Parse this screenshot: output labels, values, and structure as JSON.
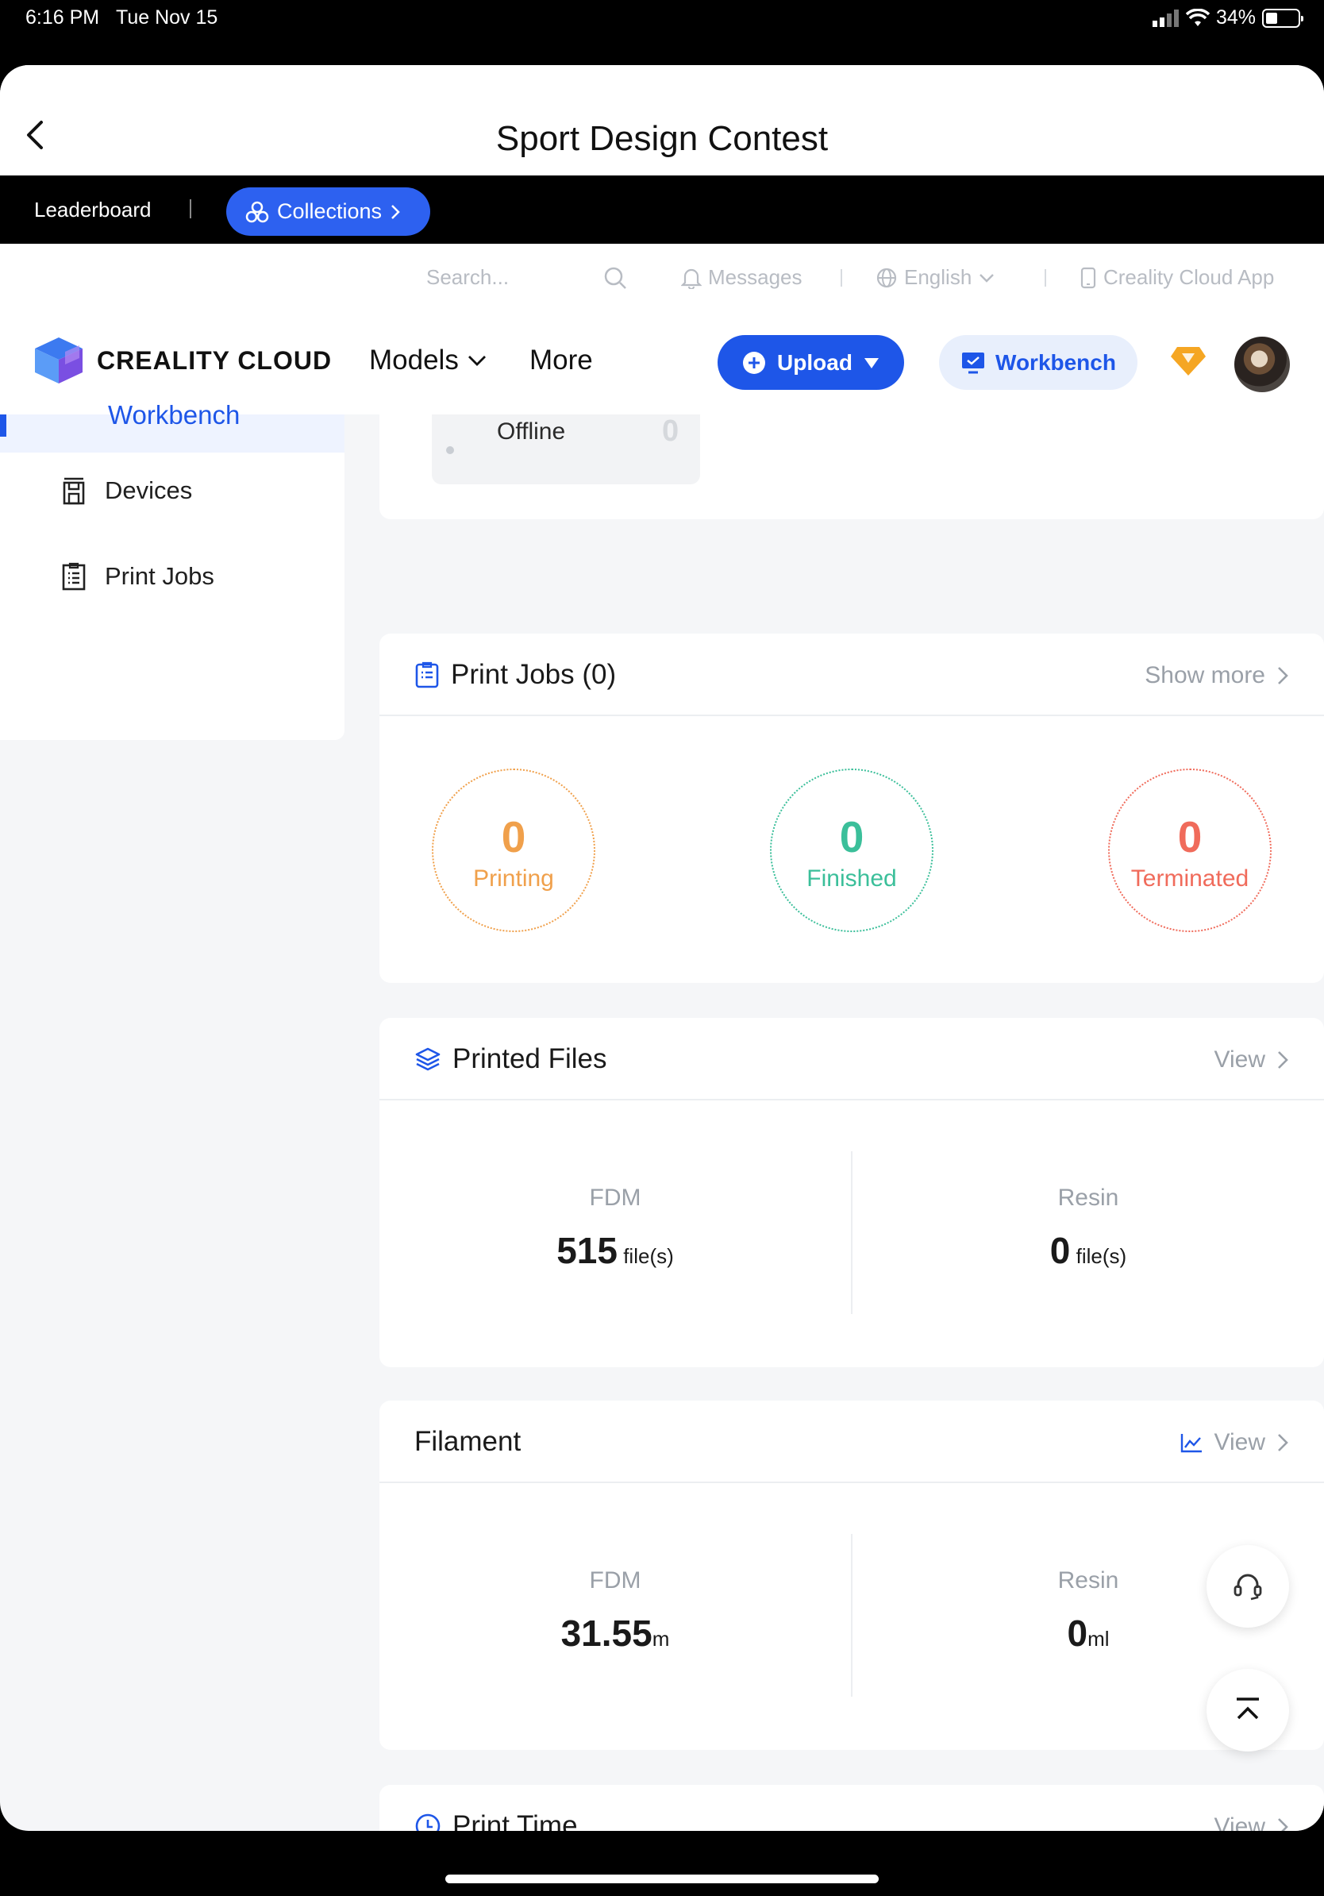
{
  "status_bar": {
    "time": "6:16 PM",
    "date": "Tue Nov 15",
    "battery": "34%",
    "battery_level": 0.34
  },
  "header": {
    "title": "Sport Design Contest"
  },
  "contest_bar": {
    "leaderboard": "Leaderboard",
    "collections": "Collections"
  },
  "top_nav": {
    "search_placeholder": "Search...",
    "messages": "Messages",
    "language": "English",
    "app": "Creality Cloud App"
  },
  "main_nav": {
    "brand": "CREALITY CLOUD",
    "models": "Models",
    "more": "More",
    "upload": "Upload",
    "workbench": "Workbench"
  },
  "sidebar": {
    "items": [
      {
        "label": "Workbench"
      },
      {
        "label": "Devices"
      },
      {
        "label": "Print Jobs"
      }
    ]
  },
  "devices": {
    "offline_label": "Offline",
    "offline_count": "0"
  },
  "print_jobs": {
    "title": "Print Jobs (0)",
    "link": "Show more",
    "stats": [
      {
        "count": "0",
        "label": "Printing",
        "color": "#f0a04b"
      },
      {
        "count": "0",
        "label": "Finished",
        "color": "#3bbf9a"
      },
      {
        "count": "0",
        "label": "Terminated",
        "color": "#f06b5b"
      }
    ]
  },
  "printed_files": {
    "title": "Printed Files",
    "link": "View",
    "fdm": {
      "type": "FDM",
      "value": "515",
      "unit": "file(s)"
    },
    "resin": {
      "type": "Resin",
      "value": "0",
      "unit": "file(s)"
    }
  },
  "filament": {
    "title": "Filament",
    "link": "View",
    "fdm": {
      "type": "FDM",
      "value": "31.55",
      "unit": "m"
    },
    "resin": {
      "type": "Resin",
      "value": "0",
      "unit": "ml"
    }
  },
  "print_time": {
    "title": "Print Time",
    "link": "View"
  },
  "colors": {
    "accent": "#1e56e8",
    "printing": "#f0a04b",
    "finished": "#3bbf9a",
    "terminated": "#f06b5b"
  }
}
